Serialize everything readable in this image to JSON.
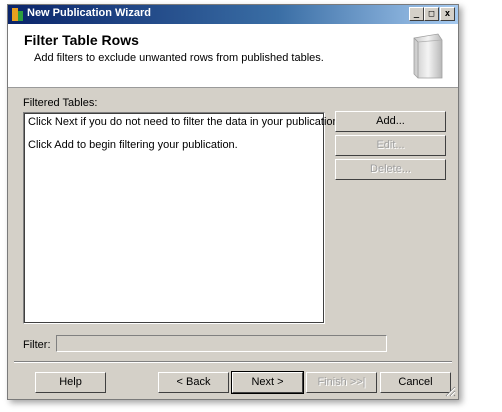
{
  "window": {
    "title": "New Publication Wizard",
    "controls": {
      "minimize": "_",
      "maximize": "□",
      "close": "x"
    }
  },
  "header": {
    "title": "Filter Table Rows",
    "subtitle": "Add filters to exclude unwanted rows from published tables."
  },
  "filtered_tables": {
    "label": "Filtered Tables:",
    "lines": [
      "Click Next if you do not need to filter the data in your publication.",
      "Click Add to begin filtering your publication."
    ]
  },
  "side_buttons": {
    "add": "Add...",
    "edit": "Edit...",
    "delete": "Delete..."
  },
  "filter": {
    "label": "Filter:",
    "value": ""
  },
  "footer": {
    "help": "Help",
    "back": "< Back",
    "next": "Next >",
    "finish": "Finish >>|",
    "cancel": "Cancel"
  }
}
